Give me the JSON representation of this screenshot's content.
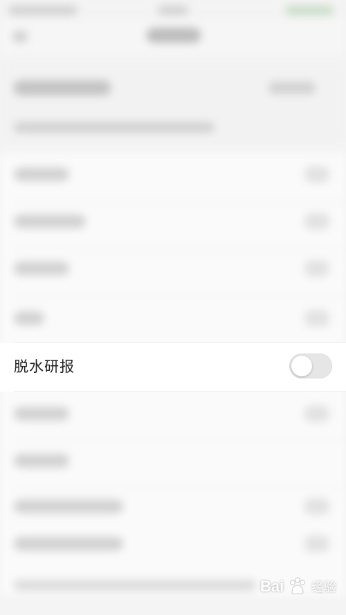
{
  "settings": {
    "visible_row": {
      "label": "脱水研报",
      "toggle_on": false
    }
  },
  "watermark": {
    "brand": "Bai",
    "brand_suffix": "经验",
    "logo_icon": "baidu-paw-icon"
  },
  "colors": {
    "background": "#f4f4f4",
    "row_background": "#ffffff",
    "switch_off": "#e6e6e6",
    "text": "#222222"
  }
}
